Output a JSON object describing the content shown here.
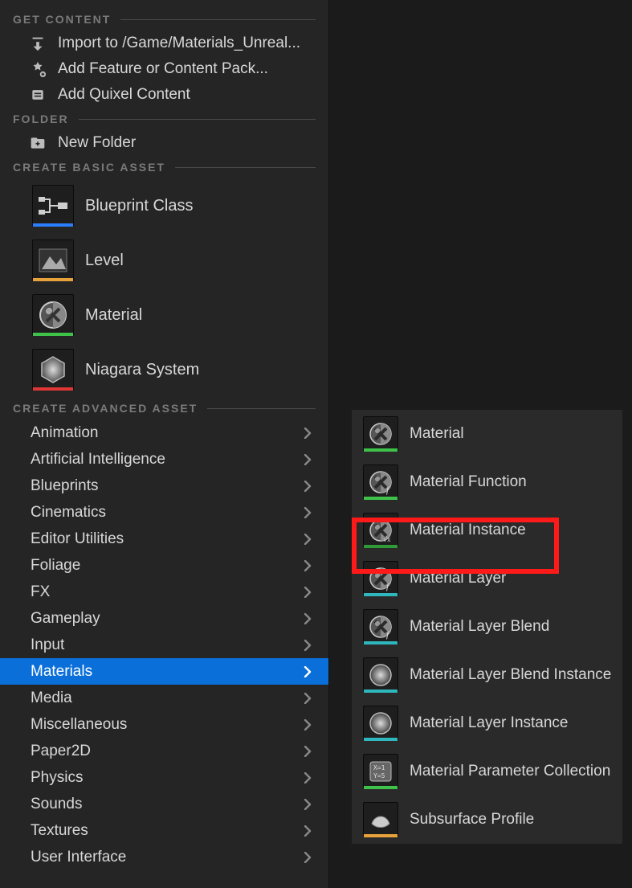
{
  "sections": {
    "get_content": {
      "header": "GET CONTENT",
      "items": [
        {
          "label": "Import to /Game/Materials_Unreal...",
          "icon": "import-icon"
        },
        {
          "label": "Add Feature or Content Pack...",
          "icon": "feature-pack-icon"
        },
        {
          "label": "Add Quixel Content",
          "icon": "quixel-icon"
        }
      ]
    },
    "folder": {
      "header": "FOLDER",
      "items": [
        {
          "label": "New Folder",
          "icon": "new-folder-icon"
        }
      ]
    },
    "basic": {
      "header": "CREATE BASIC ASSET",
      "items": [
        {
          "label": "Blueprint Class",
          "icon": "blueprint-icon",
          "underline": "#2b7fff"
        },
        {
          "label": "Level",
          "icon": "level-icon",
          "underline": "#e8a23c"
        },
        {
          "label": "Material",
          "icon": "material-icon",
          "underline": "#3ec24a"
        },
        {
          "label": "Niagara System",
          "icon": "niagara-icon",
          "underline": "#e03636"
        }
      ]
    },
    "advanced": {
      "header": "CREATE ADVANCED ASSET",
      "items": [
        {
          "label": "Animation"
        },
        {
          "label": "Artificial Intelligence"
        },
        {
          "label": "Blueprints"
        },
        {
          "label": "Cinematics"
        },
        {
          "label": "Editor Utilities"
        },
        {
          "label": "Foliage"
        },
        {
          "label": "FX"
        },
        {
          "label": "Gameplay"
        },
        {
          "label": "Input"
        },
        {
          "label": "Materials",
          "selected": true
        },
        {
          "label": "Media"
        },
        {
          "label": "Miscellaneous"
        },
        {
          "label": "Paper2D"
        },
        {
          "label": "Physics"
        },
        {
          "label": "Sounds"
        },
        {
          "label": "Textures"
        },
        {
          "label": "User Interface"
        }
      ]
    }
  },
  "submenu": {
    "items": [
      {
        "label": "Material",
        "underline": "#3ec24a"
      },
      {
        "label": "Material Function",
        "underline": "#3ec24a"
      },
      {
        "label": "Material Instance",
        "underline": "#2f9a36",
        "highlighted": true
      },
      {
        "label": "Material Layer",
        "underline": "#2fb7bd"
      },
      {
        "label": "Material Layer Blend",
        "underline": "#2fb7bd"
      },
      {
        "label": "Material Layer Blend Instance",
        "underline": "#2fb7bd"
      },
      {
        "label": "Material Layer Instance",
        "underline": "#2fb7bd"
      },
      {
        "label": "Material Parameter Collection",
        "underline": "#3ec24a"
      },
      {
        "label": "Subsurface Profile",
        "underline": "#e8a23c"
      }
    ]
  },
  "colors": {
    "highlight": "#ff1a1a",
    "selection": "#0a6fd8"
  }
}
